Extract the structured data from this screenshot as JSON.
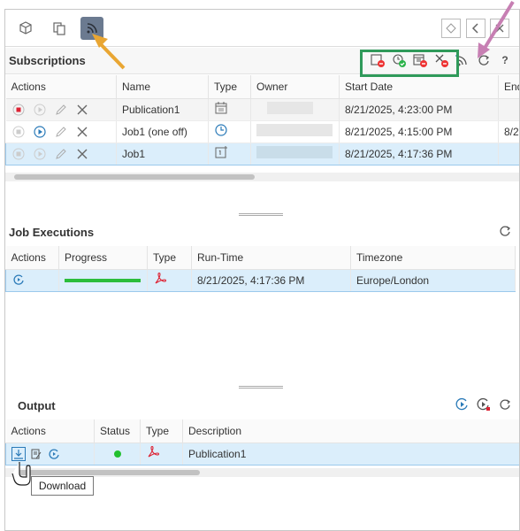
{
  "toolbar": {
    "icons": [
      "cube-icon",
      "copy-icon",
      "rss-icon"
    ],
    "nav": [
      "diamond",
      "‹",
      "×"
    ]
  },
  "subscriptions": {
    "title": "Subscriptions",
    "headers": [
      "Actions",
      "Name",
      "Type",
      "Owner",
      "Start Date",
      "End"
    ],
    "rows": [
      {
        "name": "Publication1",
        "type": "calendar-icon",
        "start": "8/21/2025, 4:23:00 PM",
        "end": ""
      },
      {
        "name": "Job1 (one off)",
        "type": "clock-icon",
        "start": "8/21/2025, 4:15:00 PM",
        "end": "8/2"
      },
      {
        "name": "Job1",
        "type": "single-run-icon",
        "start": "8/21/2025, 4:17:36 PM",
        "end": ""
      }
    ],
    "help": "?"
  },
  "jobs": {
    "title": "Job Executions",
    "headers": [
      "Actions",
      "Progress",
      "Type",
      "Run-Time",
      "Timezone"
    ],
    "rows": [
      {
        "progress": 1.0,
        "type": "pdf-icon",
        "runtime": "8/21/2025, 4:17:36 PM",
        "timezone": "Europe/London"
      }
    ]
  },
  "output": {
    "title": "Output",
    "headers": [
      "Actions",
      "Status",
      "Type",
      "Description"
    ],
    "rows": [
      {
        "status": "ok",
        "type": "pdf-icon",
        "description": "Publication1"
      }
    ]
  },
  "tooltip": "Download",
  "colors": {
    "accent_blue": "#2a7ab8",
    "selected_row": "#dbeefb",
    "progress_green": "#2bbd3b",
    "pdf_red": "#d23",
    "highlight_box": "#2f9a5a",
    "arrow_orange": "#e9a633",
    "arrow_pink": "#c77fb3"
  }
}
